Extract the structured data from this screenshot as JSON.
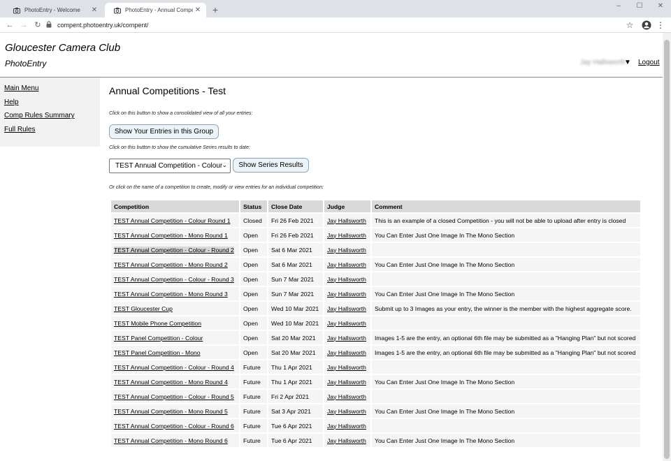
{
  "browser": {
    "tabs": [
      {
        "title": "PhotoEntry - Welcome",
        "active": false
      },
      {
        "title": "PhotoEntry - Annual Competitio",
        "active": true
      }
    ],
    "url": "compent.photoentry.uk/compent/"
  },
  "header": {
    "club_name": "Gloucester Camera Club",
    "app_name": "PhotoEntry",
    "user_name": "Jay Hallsworth",
    "user_arrow": "▼",
    "logout_label": "Logout"
  },
  "sidebar": {
    "items": [
      {
        "label": "Main Menu"
      },
      {
        "label": "Help"
      },
      {
        "label": "Comp Rules Summary"
      },
      {
        "label": "Full Rules"
      }
    ]
  },
  "main": {
    "title": "Annual Competitions - Test",
    "hint_entries": "Click on this button to show a consolidated view of all your entries:",
    "show_entries_label": "Show Your Entries in this Group",
    "hint_series": "Click on this button to show the cumulative Series results to date:",
    "series_select_value": "TEST Annual Competition - Colour",
    "show_series_label": "Show Series Results",
    "hint_table": "Or click on the name of a competition to create, modify or view entries for an individual competition:"
  },
  "table": {
    "headers": [
      "Competition",
      "Status",
      "Close Date",
      "Judge",
      "Comment"
    ],
    "rows": [
      {
        "competition": "TEST Annual Competition - Colour Round 1",
        "status": "Closed",
        "close_date": "Fri 26 Feb 2021",
        "judge": "Jay Hallsworth",
        "comment": "This is an example of a closed Competition - you will not be able to upload after entry is closed"
      },
      {
        "competition": "TEST Annual Competition - Mono Round 1",
        "status": "Open",
        "close_date": "Fri 26 Feb 2021",
        "judge": "Jay Hallsworth",
        "comment": "You Can Enter Just One Image In The Mono Section"
      },
      {
        "competition": "TEST Annual Competition - Colour - Round 2",
        "status": "Open",
        "close_date": "Sat 6 Mar 2021",
        "judge": "Jay Hallsworth",
        "comment": ""
      },
      {
        "competition": "TEST Annual Competition - Mono Round 2",
        "status": "Open",
        "close_date": "Sat 6 Mar 2021",
        "judge": "Jay Hallsworth",
        "comment": "You Can Enter Just One Image In The Mono Section"
      },
      {
        "competition": "TEST Annual Competition - Colour - Round 3",
        "status": "Open",
        "close_date": "Sun 7 Mar 2021",
        "judge": "Jay Hallsworth",
        "comment": ""
      },
      {
        "competition": "TEST Annual Competition - Mono Round 3",
        "status": "Open",
        "close_date": "Sun 7 Mar 2021",
        "judge": "Jay Hallsworth",
        "comment": "You Can Enter Just One Image In The Mono Section"
      },
      {
        "competition": "TEST Gloucester Cup",
        "status": "Open",
        "close_date": "Wed 10 Mar 2021",
        "judge": "Jay Hallsworth",
        "comment": "Submit up to 3 Images as your entry, the winner is the member with the highest aggregate score."
      },
      {
        "competition": "TEST Mobile Phone Competition",
        "status": "Open",
        "close_date": "Wed 10 Mar 2021",
        "judge": "Jay Hallsworth",
        "comment": ""
      },
      {
        "competition": "TEST Panel Competition - Colour",
        "status": "Open",
        "close_date": "Sat 20 Mar 2021",
        "judge": "Jay Hallsworth",
        "comment": "Images 1-5 are the entry, an optional 6th file may be submitted as a \"Hanging Plan\" but not scored"
      },
      {
        "competition": "TEST Panel Competition - Mono",
        "status": "Open",
        "close_date": "Sat 20 Mar 2021",
        "judge": "Jay Hallsworth",
        "comment": "Images 1-5 are the entry, an optional 6th file may be submitted as a \"Hanging Plan\" but not scored"
      },
      {
        "competition": "TEST Annual Competition - Colour - Round 4",
        "status": "Future",
        "close_date": "Thu 1 Apr 2021",
        "judge": "Jay Hallsworth",
        "comment": ""
      },
      {
        "competition": "TEST Annual Competition - Mono Round 4",
        "status": "Future",
        "close_date": "Thu 1 Apr 2021",
        "judge": "Jay Hallsworth",
        "comment": "You Can Enter Just One Image In The Mono Section"
      },
      {
        "competition": "TEST Annual Competition - Colour - Round 5",
        "status": "Future",
        "close_date": "Fri 2 Apr 2021",
        "judge": "Jay Hallsworth",
        "comment": ""
      },
      {
        "competition": "TEST Annual Competition - Mono Round 5",
        "status": "Future",
        "close_date": "Sat 3 Apr 2021",
        "judge": "Jay Hallsworth",
        "comment": "You Can Enter Just One Image In The Mono Section"
      },
      {
        "competition": "TEST Annual Competition - Colour - Round 6",
        "status": "Future",
        "close_date": "Tue 6 Apr 2021",
        "judge": "Jay Hallsworth",
        "comment": ""
      },
      {
        "competition": "TEST Annual Competition - Mono Round 6",
        "status": "Future",
        "close_date": "Tue 6 Apr 2021",
        "judge": "Jay Hallsworth",
        "comment": "You Can Enter Just One Image In The Mono Section"
      }
    ]
  }
}
